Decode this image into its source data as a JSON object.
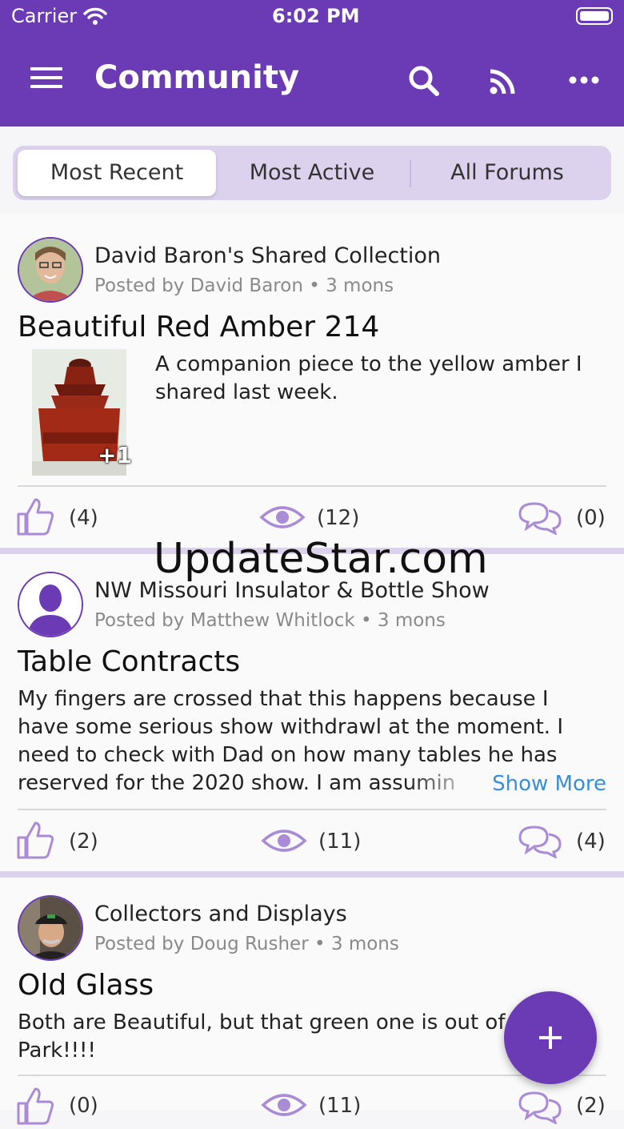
{
  "status_bar": {
    "carrier": "Carrier",
    "time": "6:02 PM"
  },
  "header": {
    "title": "Community"
  },
  "tabs": [
    {
      "label": "Most Recent",
      "active": true
    },
    {
      "label": "Most Active",
      "active": false
    },
    {
      "label": "All Forums",
      "active": false
    }
  ],
  "posts": [
    {
      "forum": "David Baron's Shared Collection",
      "posted_by": "Posted by David Baron",
      "age": "3 mons",
      "title": "Beautiful Red Amber 214",
      "body": "A companion piece to the yellow amber I shared last week.",
      "image_count": "+1",
      "likes": "(4)",
      "views": "(12)",
      "comments": "(0)"
    },
    {
      "forum": "NW Missouri Insulator & Bottle Show",
      "posted_by": "Posted by Matthew Whitlock",
      "age": "3 mons",
      "title": "Table Contracts",
      "body_lines": [
        "My fingers are crossed that this happens because I",
        "have some serious show withdrawl at the moment. I",
        "need to check with Dad on how many tables he has",
        "reserved for the 2020 show. I am assumin"
      ],
      "show_more": "Show More",
      "likes": "(2)",
      "views": "(11)",
      "comments": "(4)"
    },
    {
      "forum": "Collectors and Displays",
      "posted_by": "Posted by Doug Rusher",
      "age": "3 mons",
      "title": "Old Glass",
      "body_lines": [
        "Both are Beautiful, but that green one is out of the",
        "Park!!!!"
      ],
      "likes": "(0)",
      "views": "(11)",
      "comments": "(2)"
    }
  ],
  "watermark": "UpdateStar.com",
  "colors": {
    "primary": "#6a3bb5",
    "segment_bg": "#ddd2ee",
    "icon": "#a98bd6",
    "link": "#3a8fd6"
  }
}
